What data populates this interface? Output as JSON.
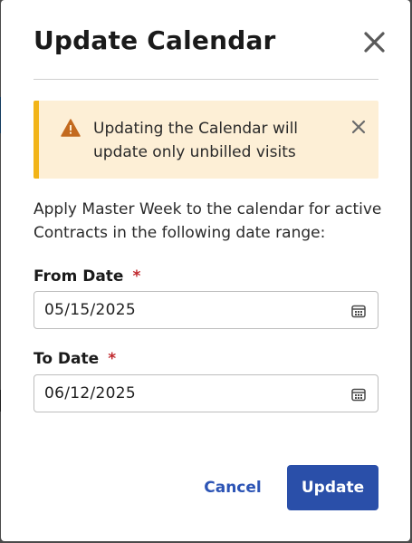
{
  "dialog": {
    "title": "Update Calendar",
    "close_icon": "close-icon"
  },
  "alert": {
    "icon": "warning-icon",
    "message": "Updating the Calendar will update only unbilled visits",
    "close_icon": "close-icon",
    "accent_color": "#f2b418",
    "background_color": "#fdefd6"
  },
  "description": "Apply Master Week to the calendar for active Contracts in the following date range:",
  "from_date": {
    "label": "From Date",
    "required_marker": "*",
    "value": "05/15/2025",
    "icon": "calendar-icon"
  },
  "to_date": {
    "label": "To Date",
    "required_marker": "*",
    "value": "06/12/2025",
    "icon": "calendar-icon"
  },
  "actions": {
    "cancel_label": "Cancel",
    "update_label": "Update",
    "primary_color": "#2a4fa9",
    "link_color": "#2c54b5"
  }
}
